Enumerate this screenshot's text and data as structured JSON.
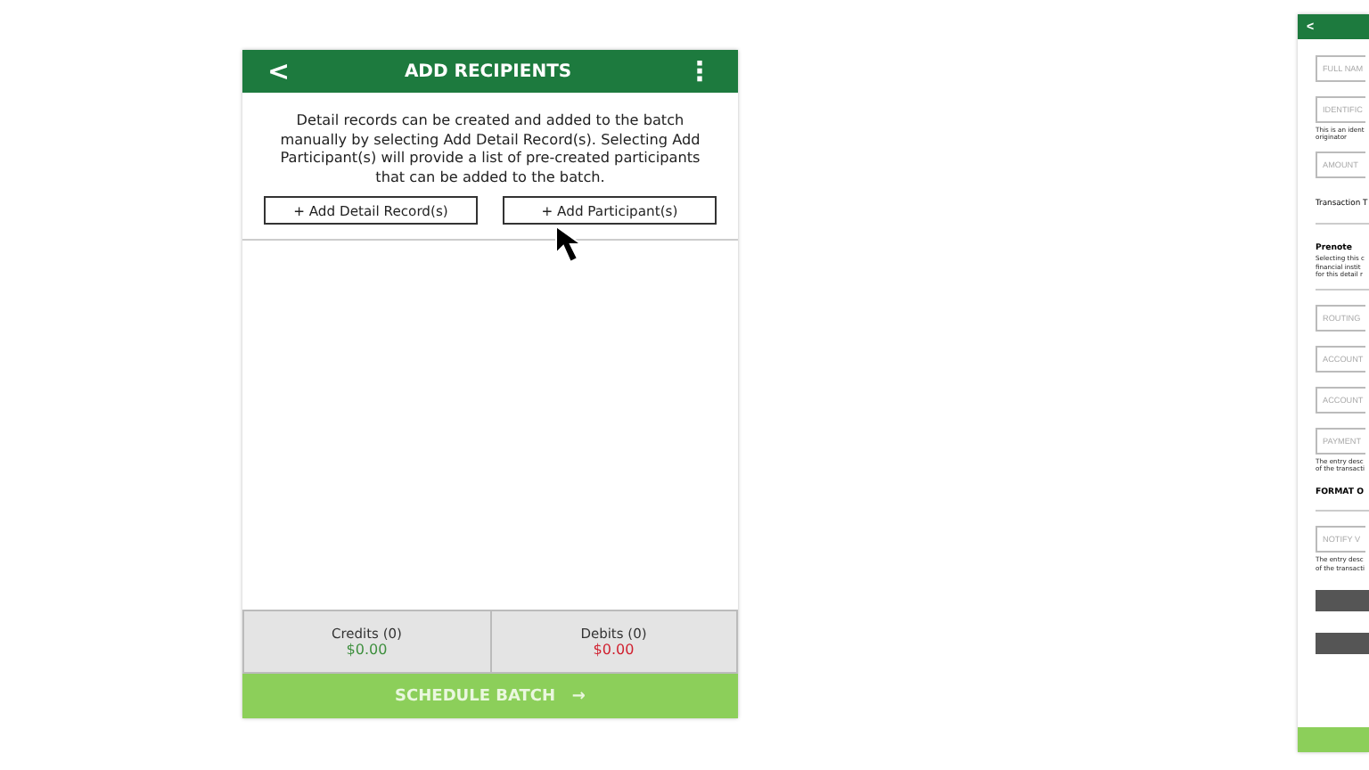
{
  "main_screen": {
    "header": {
      "back": "<",
      "title": "ADD RECIPIENTS",
      "menu": "⋮"
    },
    "intro": "Detail records can be created and added to the batch manually by selecting Add Detail Record(s). Selecting Add Participant(s) will provide a list of pre-created participants that can be added to the batch.",
    "actions": [
      "+ Add Detail Record(s)",
      "+ Add Participant(s)"
    ],
    "totals": [
      {
        "label": "Credits (0)",
        "amount": "$0.00",
        "kind": "credit"
      },
      {
        "label": "Debits (0)",
        "amount": "$0.00",
        "kind": "debit"
      }
    ],
    "footer_button": {
      "label": "SCHEDULE BATCH",
      "arrow": "→"
    }
  },
  "side_screen": {
    "header": {
      "back": "<"
    },
    "items": [
      {
        "kind": "field",
        "placeholder": "FULL NAM"
      },
      {
        "kind": "field",
        "placeholder": "IDENTIFIC"
      },
      {
        "kind": "note",
        "text": "This is an ident"
      },
      {
        "kind": "note",
        "text": "originator"
      },
      {
        "kind": "field",
        "placeholder": "AMOUNT"
      },
      {
        "kind": "label",
        "text": "Transaction T"
      },
      {
        "kind": "divider"
      },
      {
        "kind": "heading",
        "text": "Prenote"
      },
      {
        "kind": "note",
        "text": "Selecting this c"
      },
      {
        "kind": "note",
        "text": "financial instit"
      },
      {
        "kind": "note",
        "text": "for this detail r"
      },
      {
        "kind": "divider"
      },
      {
        "kind": "field",
        "placeholder": "ROUTING"
      },
      {
        "kind": "field",
        "placeholder": "ACCOUNT"
      },
      {
        "kind": "field",
        "placeholder": "ACCOUNT"
      },
      {
        "kind": "field",
        "placeholder": "PAYMENT"
      },
      {
        "kind": "note",
        "text": "The entry desc"
      },
      {
        "kind": "note",
        "text": "of the transacti"
      },
      {
        "kind": "heading",
        "text": "FORMAT O"
      },
      {
        "kind": "divider"
      },
      {
        "kind": "field",
        "placeholder": "NOTIFY V"
      },
      {
        "kind": "note",
        "text": "The entry desc"
      },
      {
        "kind": "note",
        "text": "of the transacti"
      },
      {
        "kind": "button"
      },
      {
        "kind": "button"
      }
    ]
  }
}
